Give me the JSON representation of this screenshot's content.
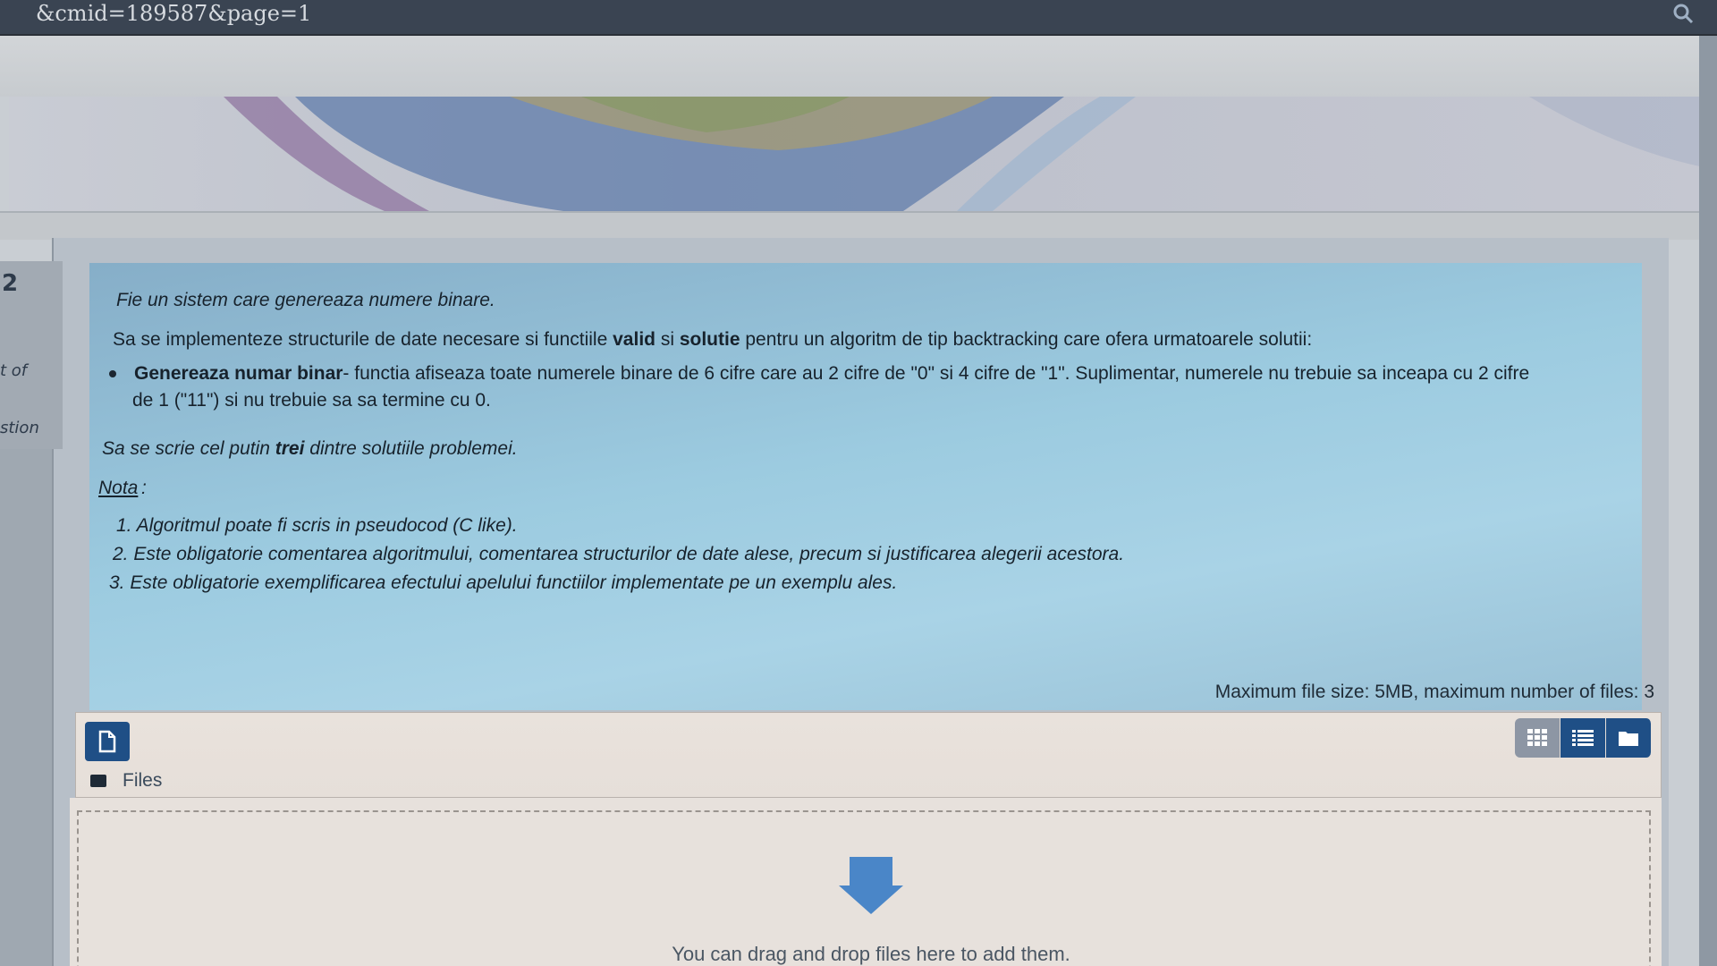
{
  "browser": {
    "url_fragment": "&cmid=189587&page=1",
    "zoom_icon": "magnifier-icon"
  },
  "sidebar": {
    "question_number": "2",
    "label_partial_1": "t of",
    "label_partial_2": "stion"
  },
  "question": {
    "intro_normal": "Fie un sistem care ",
    "intro_italic": "genereaza numere binare.",
    "task_part1": "Sa se implementeze structurile de date necesare si functiile ",
    "task_bold1": "valid",
    "task_part2": " si ",
    "task_bold2": "solutie",
    "task_part3": " pentru un algoritm de tip backtracking care ofera urmatoarele solutii:",
    "bullet_bold": "Genereaza numar binar",
    "bullet_text_line1": "- functia afiseaza toate numerele binare de 6 cifre care au 2 cifre de \"0\" si 4 cifre de \"1\". Suplimentar, numerele nu trebuie sa inceapa cu 2 cifre",
    "bullet_text_line2": "de 1 (\"11\") si nu trebuie sa sa termine cu 0.",
    "write_part1": "Sa se scrie cel putin ",
    "write_bold": "trei",
    "write_part2": " dintre solutiile problemei.",
    "nota_label": "Nota",
    "nota_colon": ":",
    "notes": [
      "1. Algoritmul poate fi scris in pseudocod (C like).",
      "2. Este obligatorie comentarea algoritmului, comentarea structurilor de date alese, precum si justificarea alegerii acestora.",
      "3. Este obligatorie exemplificarea efectului apelului functiilor implementate pe un exemplu ales."
    ]
  },
  "filemanager": {
    "max_info": "Maximum file size: 5MB, maximum number of files: 3",
    "path_label": "Files",
    "drop_text": "You can drag and drop files here to add them.",
    "icons": {
      "new_file": "add-file-icon",
      "grid_view": "grid-view-icon",
      "list_view": "list-view-icon",
      "tree_view": "folder-view-icon",
      "drop_arrow": "download-arrow-icon"
    }
  },
  "colors": {
    "accent_blue": "#1f4f86",
    "question_bg": "#9ccbe0",
    "drop_arrow": "#4a86c8"
  }
}
